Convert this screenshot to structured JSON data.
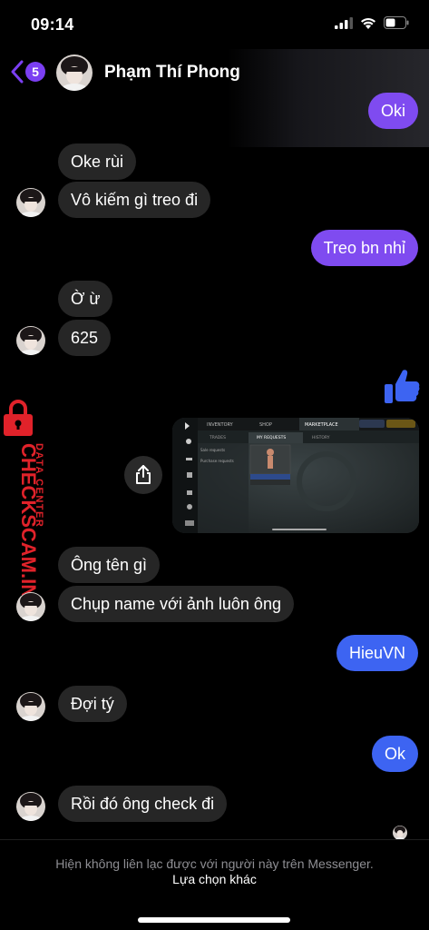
{
  "status_bar": {
    "time": "09:14"
  },
  "header": {
    "back_badge": "5",
    "contact_name": "Phạm Thí Phong"
  },
  "messages": [
    {
      "text": "Oki"
    },
    {
      "text": "Oke rùi"
    },
    {
      "text": "Vô kiếm gì treo đi"
    },
    {
      "text": "Treo bn nhỉ"
    },
    {
      "text": "Ờ ừ"
    },
    {
      "text": "625"
    },
    {
      "text": "Ông tên gì"
    },
    {
      "text": "Chụp name với ảnh luôn ông"
    },
    {
      "text": "HieuVN"
    },
    {
      "text": "Đợi tý"
    },
    {
      "text": "Ok"
    },
    {
      "text": "Rồi đó ông check đi"
    }
  ],
  "screenshot_ui": {
    "tabs": [
      "INVENTORY",
      "SHOP",
      "MARKETPLACE"
    ],
    "subtabs": [
      "TRADES",
      "MY REQUESTS",
      "HISTORY"
    ],
    "menu": [
      "Sale requests",
      "Purchase requests"
    ]
  },
  "watermark": {
    "line1": "DATA CENTER",
    "line2": "CHECKSCAM.INFO"
  },
  "footer": {
    "notice": "Hiện không liên lạc được với người này trên Messenger.",
    "link": "Lựa chọn khác"
  },
  "colors": {
    "purple": "#7f4bf0",
    "blue": "#3d64f2",
    "incoming": "#262626",
    "watermark": "#e0222a"
  }
}
